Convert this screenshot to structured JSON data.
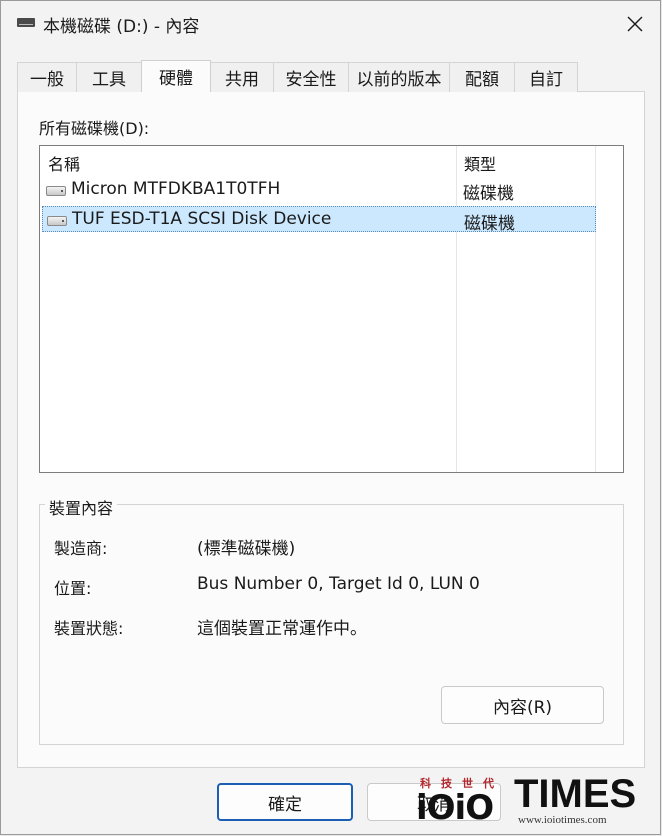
{
  "window": {
    "title": "本機磁碟 (D:) - 內容"
  },
  "tabs": [
    {
      "label": "一般"
    },
    {
      "label": "工具"
    },
    {
      "label": "硬體"
    },
    {
      "label": "共用"
    },
    {
      "label": "安全性"
    },
    {
      "label": "以前的版本"
    },
    {
      "label": "配額"
    },
    {
      "label": "自訂"
    }
  ],
  "active_tab": "硬體",
  "disk_list": {
    "label": "所有磁碟機(D):",
    "columns": {
      "name": "名稱",
      "type": "類型"
    },
    "rows": [
      {
        "name": "Micron MTFDKBA1T0TFH",
        "type": "磁碟機"
      },
      {
        "name": "TUF ESD-T1A SCSI Disk Device",
        "type": "磁碟機"
      }
    ],
    "selected_row": "TUF ESD-T1A SCSI Disk Device"
  },
  "device_properties": {
    "group_label": "裝置內容",
    "manufacturer_label": "製造商:",
    "manufacturer_value": "(標準磁碟機)",
    "location_label": "位置:",
    "location_value": "Bus Number 0, Target Id 0, LUN 0",
    "status_label": "裝置狀態:",
    "status_value": "這個裝置正常運作中。",
    "properties_button": "內容(R)"
  },
  "footer": {
    "ok_button": "確定",
    "second_button": "取消"
  },
  "watermark": {
    "sub": "科技世代",
    "brand": "iOiO",
    "name": "TIMES",
    "url": "www.ioiotimes.com"
  },
  "colors": {
    "selection": "#cce8ff",
    "accent": "#1a5fb4",
    "watermark_red": "#b3282d"
  }
}
